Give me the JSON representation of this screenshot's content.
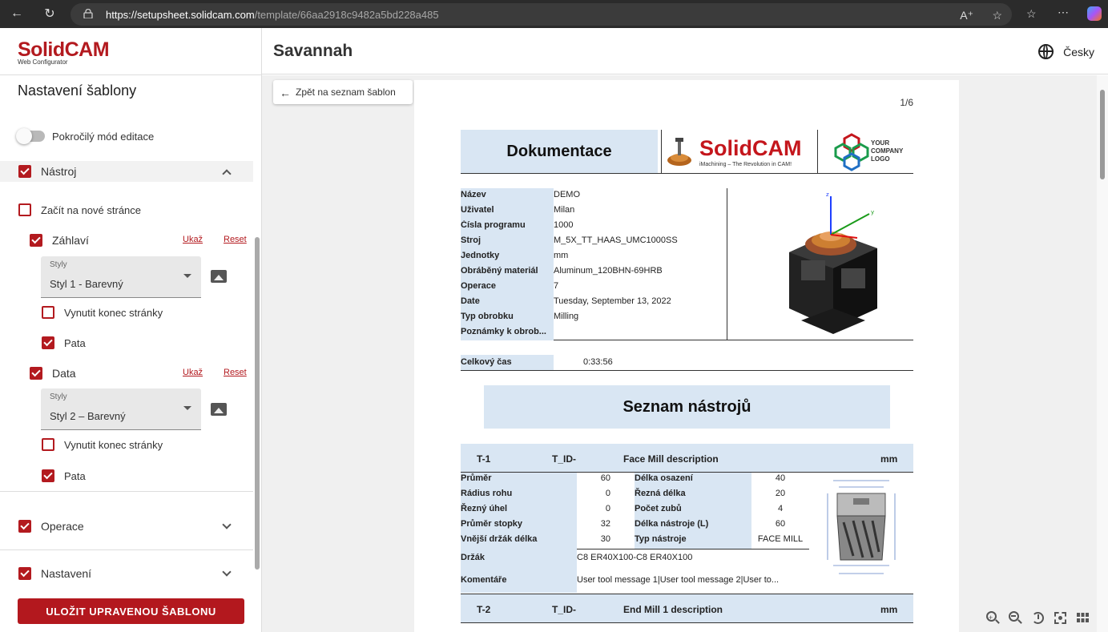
{
  "browser": {
    "url_host": "https://setupsheet.solidcam.com",
    "url_path": "/template/66aa2918c9482a5bd228a485"
  },
  "sidebar": {
    "logo_main": "SolidCAM",
    "logo_sub": "Web Configurator",
    "title": "Nastavení šablony",
    "advanced_mode_label": "Pokročilý mód editace",
    "advanced_mode_on": false,
    "sections": {
      "tool": {
        "label": "Nástroj",
        "checked": true,
        "expanded": true
      },
      "start_new_page": {
        "label": "Začít na nové stránce",
        "checked": false
      },
      "header": {
        "label": "Záhlaví",
        "checked": true,
        "show": "Ukaž",
        "reset": "Reset",
        "style_label": "Styly",
        "style_value": "Styl 1 - Barevný",
        "force_end": "Vynutit konec stránky",
        "force_end_checked": false,
        "footer": "Pata",
        "footer_checked": true
      },
      "data": {
        "label": "Data",
        "checked": true,
        "show": "Ukaž",
        "reset": "Reset",
        "style_label": "Styly",
        "style_value": "Styl 2 – Barevný",
        "force_end": "Vynutit konec stránky",
        "force_end_checked": false,
        "footer": "Pata",
        "footer_checked": true
      },
      "operation": {
        "label": "Operace",
        "checked": true
      },
      "setup": {
        "label": "Nastavení",
        "checked": true
      }
    },
    "save_label": "ULOŽIT UPRAVENOU ŠABLONU"
  },
  "topbar": {
    "title": "Savannah",
    "language": "Česky"
  },
  "workspace": {
    "back_label": "Zpět na seznam šablon",
    "page_number": "1/6"
  },
  "doc": {
    "title": "Dokumentace",
    "solidcam_logo": "SolidCAM",
    "solidcam_tagline": "iMachining – The Revolution in CAM!",
    "company_logo": [
      "YOUR",
      "COMPANY",
      "LOGO"
    ],
    "info": [
      {
        "k": "Název",
        "v": "DEMO"
      },
      {
        "k": "Uživatel",
        "v": "Milan"
      },
      {
        "k": "Čísla programu",
        "v": "1000"
      },
      {
        "k": "Stroj",
        "v": "M_5X_TT_HAAS_UMC1000SS"
      },
      {
        "k": "Jednotky",
        "v": "mm"
      },
      {
        "k": "Obráběný materiál",
        "v": "Aluminum_120BHN-69HRB"
      },
      {
        "k": "Operace",
        "v": "7"
      },
      {
        "k": "Date",
        "v": "Tuesday, September 13, 2022"
      },
      {
        "k": "Typ obrobku",
        "v": "Milling"
      },
      {
        "k": "Poznámky k obrob...",
        "v": ""
      }
    ],
    "total_label": "Celkový čas",
    "total_value": "0:33:56",
    "tools_title": "Seznam nástrojů",
    "tools": [
      {
        "num": "T-1",
        "id": "T_ID-",
        "desc": "Face Mill description",
        "unit": "mm",
        "left": [
          [
            "Průměr",
            "60"
          ],
          [
            "Rádius rohu",
            "0"
          ],
          [
            "Řezný úhel",
            "0"
          ],
          [
            "Průměr stopky",
            "32"
          ],
          [
            "Vnější držák délka",
            "30"
          ]
        ],
        "right": [
          [
            "Délka osazení",
            "40"
          ],
          [
            "Řezná délka",
            "20"
          ],
          [
            "Počet zubů",
            "4"
          ],
          [
            "Délka nástroje (L)",
            "60"
          ],
          [
            "Typ nástroje",
            "FACE MILL"
          ]
        ],
        "holder_label": "Držák",
        "holder": "C8 ER40X100-C8 ER40X100",
        "comment_label": "Komentáře",
        "comment": "User tool message 1|User tool message 2|User to..."
      },
      {
        "num": "T-2",
        "id": "T_ID-",
        "desc": "End Mill 1 description",
        "unit": "mm"
      }
    ]
  }
}
